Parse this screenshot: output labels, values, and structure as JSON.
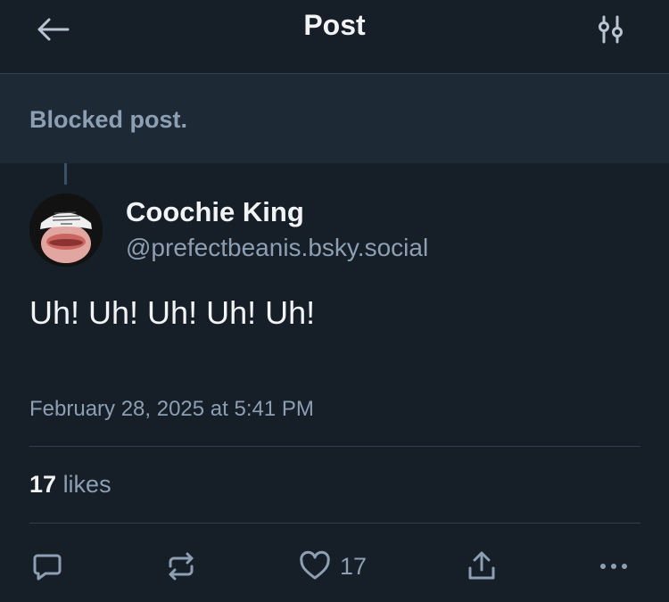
{
  "header": {
    "title": "Post",
    "back_icon": "arrow-left-icon",
    "settings_icon": "sliders-icon"
  },
  "blocked": {
    "text": "Blocked post."
  },
  "post": {
    "author_name": "Coochie King",
    "author_handle": "@prefectbeanis.bsky.social",
    "text": "Uh! Uh! Uh! Uh! Uh!",
    "timestamp": "February 28, 2025 at 5:41 PM"
  },
  "stats": {
    "likes_count": "17",
    "likes_label": "likes"
  },
  "actions": {
    "reply_icon": "reply-icon",
    "repost_icon": "repost-icon",
    "like_icon": "heart-icon",
    "like_count": "17",
    "share_icon": "share-icon",
    "more_icon": "more-icon"
  },
  "colors": {
    "background": "#161e27",
    "blocked_background": "#1e2936",
    "muted_text": "#8d9fb3",
    "primary_text": "#f1f3f5",
    "divider": "#2e4052"
  }
}
